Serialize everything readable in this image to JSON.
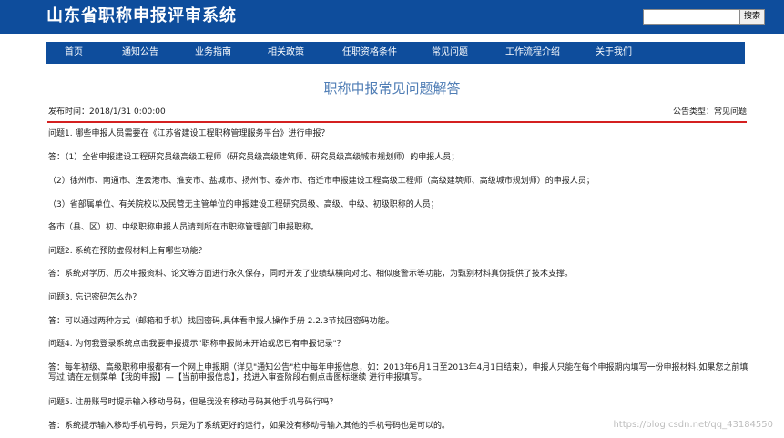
{
  "header": {
    "site_title": "山东省职称申报评审系统",
    "search_placeholder": "",
    "search_button": "搜索"
  },
  "nav": [
    {
      "label": "首页"
    },
    {
      "label": "通知公告"
    },
    {
      "label": "业务指南"
    },
    {
      "label": "相关政策"
    },
    {
      "label": "任职资格条件"
    },
    {
      "label": "常见问题"
    },
    {
      "label": "工作流程介绍"
    },
    {
      "label": "关于我们"
    }
  ],
  "article": {
    "title": "职称申报常见问题解答",
    "publish_time": "发布时间：2018/1/31 0:00:00",
    "category": "公告类型：常见问题",
    "paragraphs": [
      "问题1. 哪些申报人员需要在《江苏省建设工程职称管理服务平台》进行申报？",
      "答：（1）全省申报建设工程研究员级高级工程师（研究员级高级建筑师、研究员级高级城市规划师）的申报人员；",
      "（2）徐州市、南通市、连云港市、淮安市、盐城市、扬州市、泰州市、宿迁市申报建设工程高级工程师（高级建筑师、高级城市规划师）的申报人员；",
      "（3）省部属单位、有关院校以及民营无主管单位的申报建设工程研究员级、高级、中级、初级职称的人员；",
      "各市（县、区）初、中级职称申报人员请到所在市职称管理部门申报职称。",
      "问题2. 系统在预防虚假材料上有哪些功能？",
      "答：系统对学历、历次申报资料、论文等方面进行永久保存，同时开发了业绩纵横向对比、相似度警示等功能，为甄别材料真伪提供了技术支撑。",
      "问题3. 忘记密码怎么办？",
      "答：可以通过两种方式（邮箱和手机）找回密码,具体看申报人操作手册 2.2.3节找回密码功能。",
      "问题4. 为何我登录系统点击我要申报提示\"职称申报尚未开始或您已有申报记录\"？",
      "答：每年初级、高级职称申报都有一个网上申报期（详见\"通知公告\"栏中每年申报信息，如：2013年6月1日至2013年4月1日结束），申报人只能在每个申报期内填写一份申报材料,如果您之前填写过,请在左侧菜单【我的申报】—【当前申报信息】，找进入审查阶段右侧点击图标继续 进行申报填写。",
      "问题5. 注册账号时提示输入移动号码，但是我没有移动号码其他手机号码行吗？",
      "答：系统提示输入移动手机号码，只是为了系统更好的运行，如果没有移动号输入其他的手机号码也是可以的。"
    ]
  },
  "watermark": "https://blog.csdn.net/qq_43184550",
  "colors": {
    "header_bg": "#0e4d9c",
    "nav_bg": "#0e4d9c",
    "title_color": "#4f7db5",
    "rule_color": "#d42020"
  }
}
